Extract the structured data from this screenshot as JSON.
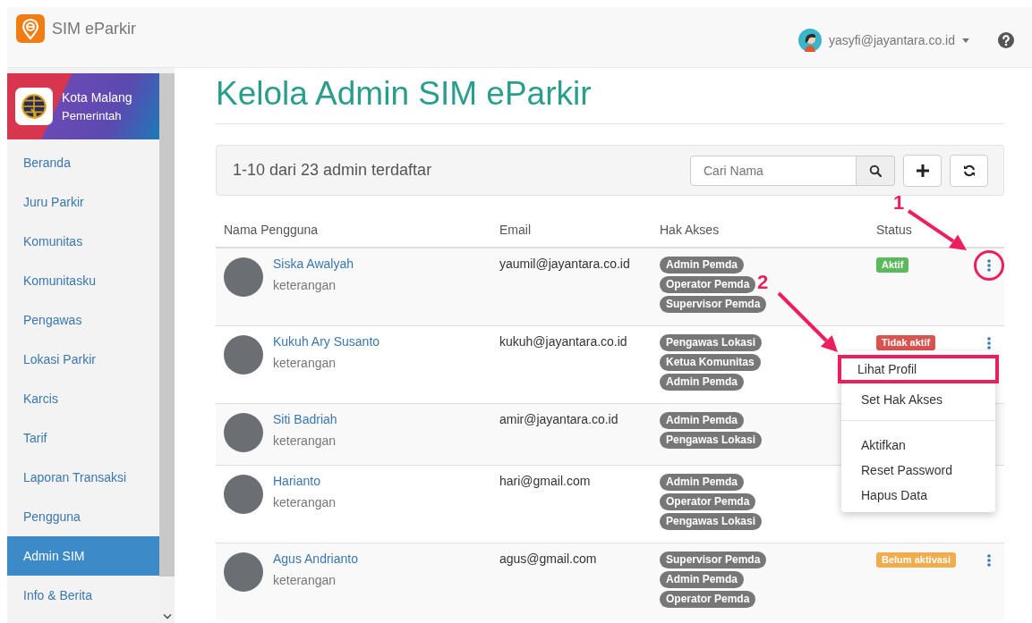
{
  "app": {
    "title": "SIM eParkir"
  },
  "user": {
    "email": "yasyfi@jayantara.co.id"
  },
  "sidebar": {
    "org_name": "Kota Malang",
    "org_type": "Pemerintah",
    "items": [
      {
        "label": "Beranda",
        "selected": false
      },
      {
        "label": "Juru Parkir",
        "selected": false
      },
      {
        "label": "Komunitas",
        "selected": false
      },
      {
        "label": "Komunitasku",
        "selected": false
      },
      {
        "label": "Pengawas",
        "selected": false
      },
      {
        "label": "Lokasi Parkir",
        "selected": false
      },
      {
        "label": "Karcis",
        "selected": false
      },
      {
        "label": "Tarif",
        "selected": false
      },
      {
        "label": "Laporan Transaksi",
        "selected": false
      },
      {
        "label": "Pengguna",
        "selected": false
      },
      {
        "label": "Admin SIM",
        "selected": true
      },
      {
        "label": "Info & Berita",
        "selected": false
      }
    ]
  },
  "page": {
    "title": "Kelola Admin SIM eParkir"
  },
  "toolbar": {
    "summary": "1-10 dari 23 admin terdaftar",
    "search": {
      "placeholder": "Cari Nama"
    }
  },
  "table": {
    "columns": [
      "Nama Pengguna",
      "Email",
      "Hak Akses",
      "Status"
    ],
    "rows": [
      {
        "name": "Siska Awalyah",
        "note": "keterangan",
        "email": "yaumil@jayantara.co.id",
        "roles": [
          "Admin Pemda",
          "Operator Pemda",
          "Supervisor Pemda"
        ],
        "status": {
          "label": "Aktif",
          "color": "#5cb85c"
        },
        "action": {
          "circled": true,
          "menu_open": false
        }
      },
      {
        "name": "Kukuh Ary Susanto",
        "note": "keterangan",
        "email": "kukuh@jayantara.co.id",
        "roles": [
          "Pengawas Lokasi",
          "Ketua Komunitas",
          "Admin Pemda"
        ],
        "status": {
          "label": "Tidak aktif",
          "color": "#d9534f"
        },
        "action": {
          "circled": false,
          "menu_open": true
        }
      },
      {
        "name": "Siti Badriah",
        "note": "keterangan",
        "email": "amir@jayantara.co.id",
        "roles": [
          "Admin Pemda",
          "Pengawas Lokasi"
        ]
      },
      {
        "name": "Harianto",
        "note": "keterangan",
        "email": "hari@gmail.com",
        "roles": [
          "Admin Pemda",
          "Operator Pemda",
          "Pengawas Lokasi"
        ]
      },
      {
        "name": "Agus Andrianto",
        "note": "keterangan",
        "email": "agus@gmail.com",
        "roles": [
          "Supervisor Pemda",
          "Admin Pemda",
          "Operator Pemda"
        ],
        "status": {
          "label": "Belum aktivasi",
          "color": "#f0ad4e"
        },
        "action": {
          "circled": false,
          "menu_open": false
        }
      }
    ]
  },
  "row_menu": {
    "groups": [
      [
        {
          "label": "Lihat Profil",
          "highlighted": true
        },
        {
          "label": "Set Hak Akses",
          "highlighted": false
        }
      ],
      [
        {
          "label": "Aktifkan",
          "highlighted": false
        },
        {
          "label": "Reset Password",
          "highlighted": false
        },
        {
          "label": "Hapus Data",
          "highlighted": false
        }
      ]
    ]
  },
  "annotations": [
    {
      "label": "1"
    },
    {
      "label": "2"
    }
  ]
}
